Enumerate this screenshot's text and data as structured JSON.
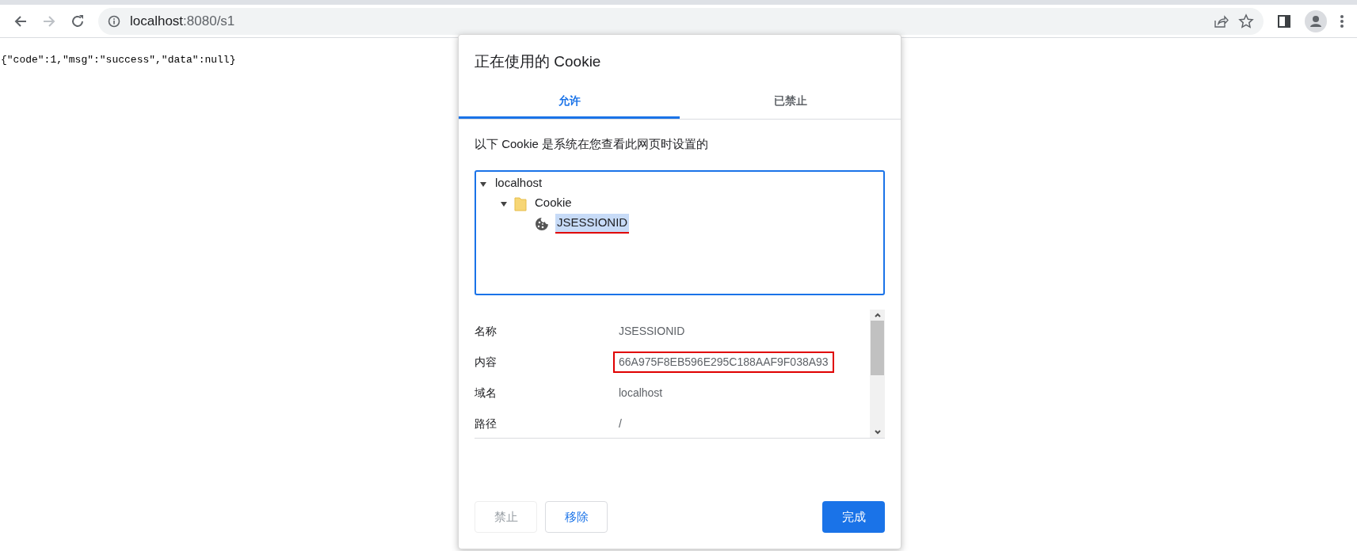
{
  "browser": {
    "url_host": "localhost",
    "url_rest": ":8080/s1",
    "forward_disabled": true
  },
  "page": {
    "body_text": "{\"code\":1,\"msg\":\"success\",\"data\":null}"
  },
  "dialog": {
    "title": "正在使用的 Cookie",
    "tabs": [
      {
        "label": "允许",
        "selected": true
      },
      {
        "label": "已禁止",
        "selected": false
      }
    ],
    "description": "以下 Cookie 是系统在您查看此网页时设置的",
    "tree": [
      {
        "label": "localhost",
        "expanded": true,
        "selected": false,
        "annotated": false,
        "children": [
          {
            "label": "Cookie",
            "kind": "folder",
            "expanded": true,
            "selected": false,
            "annotated": false,
            "children": [
              {
                "label": "JSESSIONID",
                "kind": "cookie",
                "selected": true,
                "annotated": true
              }
            ]
          }
        ]
      }
    ],
    "details": [
      {
        "label": "名称",
        "value": "JSESSIONID",
        "annotated": false
      },
      {
        "label": "内容",
        "value": "66A975F8EB596E295C188AAF9F038A93",
        "annotated": true
      },
      {
        "label": "域名",
        "value": "localhost",
        "annotated": false
      },
      {
        "label": "路径",
        "value": "/",
        "annotated": false
      }
    ],
    "buttons": [
      {
        "label": "禁止",
        "kind": "secondary",
        "disabled": true
      },
      {
        "label": "移除",
        "kind": "secondary",
        "disabled": false
      },
      {
        "label": "完成",
        "kind": "primary",
        "disabled": false
      }
    ]
  }
}
